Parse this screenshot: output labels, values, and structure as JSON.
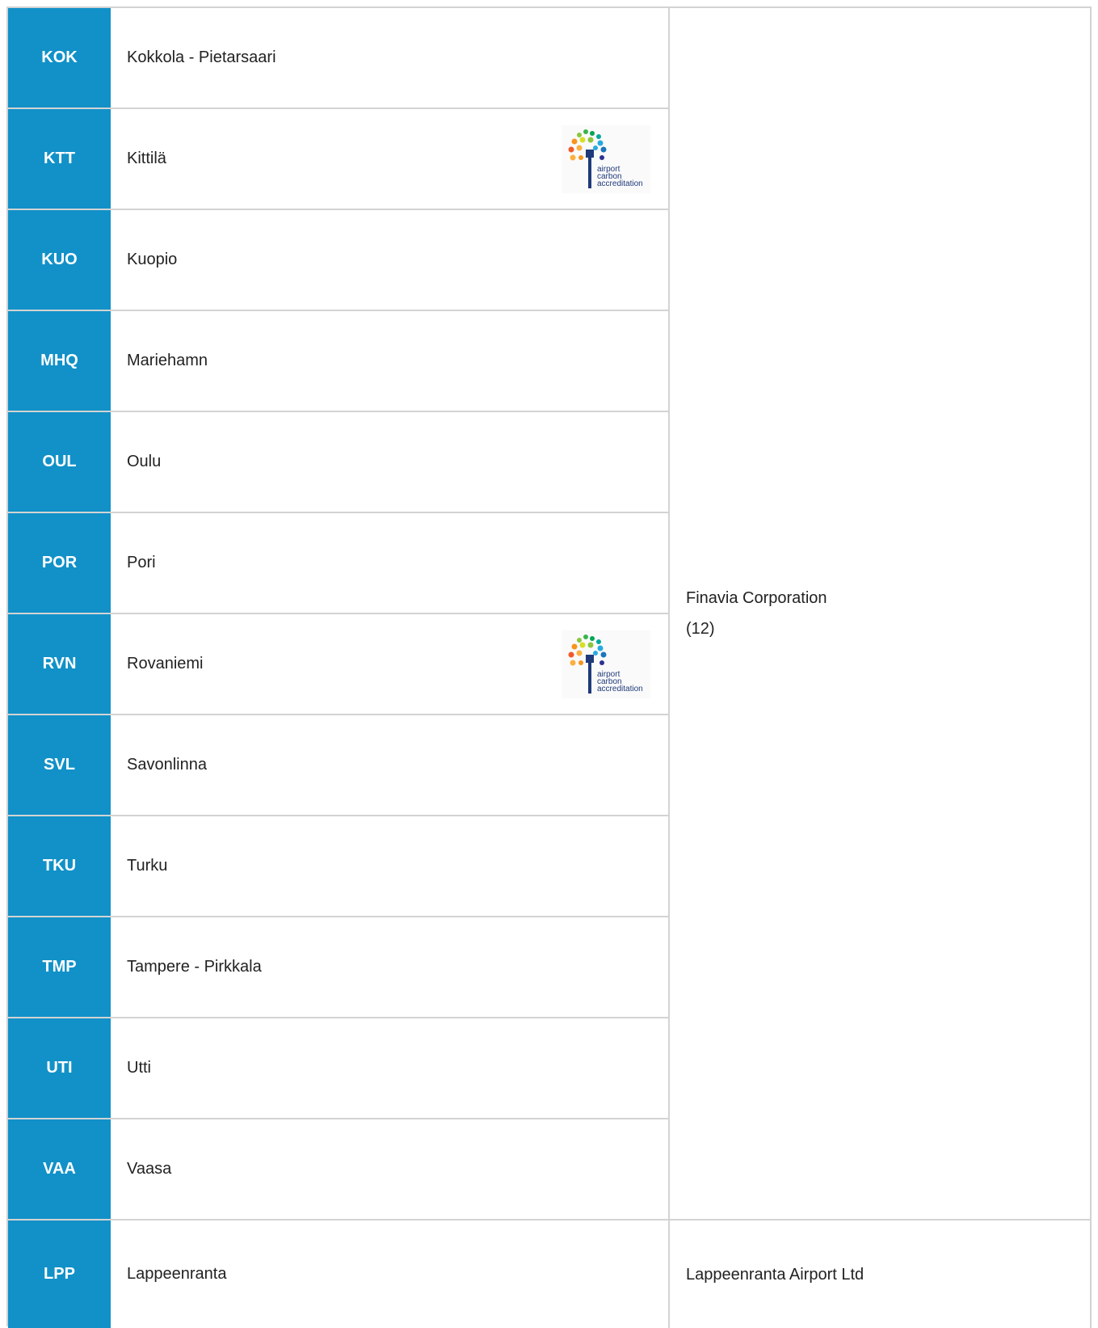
{
  "rows": [
    {
      "code": "KOK",
      "name": "Kokkola - Pietarsaari",
      "logo": false
    },
    {
      "code": "KTT",
      "name": "Kittilä",
      "logo": true
    },
    {
      "code": "KUO",
      "name": "Kuopio",
      "logo": false
    },
    {
      "code": "MHQ",
      "name": "Mariehamn",
      "logo": false
    },
    {
      "code": "OUL",
      "name": "Oulu",
      "logo": false
    },
    {
      "code": "POR",
      "name": "Pori",
      "logo": false
    },
    {
      "code": "RVN",
      "name": "Rovaniemi",
      "logo": true
    },
    {
      "code": "SVL",
      "name": "Savonlinna",
      "logo": false
    },
    {
      "code": "TKU",
      "name": "Turku",
      "logo": false
    },
    {
      "code": "TMP",
      "name": "Tampere - Pirkkala",
      "logo": false
    },
    {
      "code": "UTI",
      "name": "Utti",
      "logo": false
    },
    {
      "code": "VAA",
      "name": "Vaasa",
      "logo": false
    },
    {
      "code": "LPP",
      "name": "Lappeenranta",
      "logo": false
    }
  ],
  "owners": [
    {
      "name": "Finavia Corporation",
      "count": "(12)"
    },
    {
      "name": "Lappeenranta Airport Ltd",
      "count": ""
    }
  ],
  "logo": {
    "icon": "airport-carbon-accreditation-logo",
    "line1": "airport",
    "line2": "carbon",
    "line3": "accreditation"
  },
  "colors": {
    "code_bg": "#1191c8",
    "border": "#d3d3d3",
    "logo_text": "#1f3a7a"
  }
}
